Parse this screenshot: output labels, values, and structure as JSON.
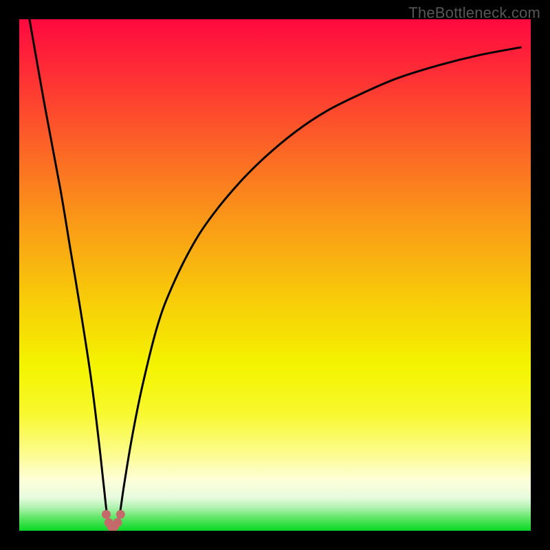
{
  "watermark": "TheBottleneck.com",
  "chart_data": {
    "type": "line",
    "title": "",
    "xlabel": "",
    "ylabel": "",
    "xlim": [
      0,
      100
    ],
    "ylim": [
      0,
      100
    ],
    "grid": false,
    "background": "red-yellow-green vertical gradient",
    "series": [
      {
        "name": "bottleneck-curve",
        "x": [
          2,
          5,
          8,
          10,
          12,
          14,
          15.5,
          16.5,
          17.2,
          18,
          18.8,
          19.6,
          20.5,
          22,
          24,
          27,
          30,
          34,
          38,
          43,
          48,
          54,
          60,
          67,
          74,
          82,
          90,
          98
        ],
        "y": [
          100,
          83,
          67,
          55,
          43,
          30,
          18,
          9,
          3,
          0,
          0,
          3,
          9,
          18,
          28,
          40,
          48,
          56,
          62,
          68,
          73,
          78,
          82,
          85.5,
          88.5,
          91,
          93,
          94.5
        ]
      }
    ],
    "markers": {
      "name": "minimum-markers",
      "color": "#c46a6a",
      "points": [
        {
          "x": 17.0,
          "y": 3.2
        },
        {
          "x": 17.5,
          "y": 1.6
        },
        {
          "x": 18.0,
          "y": 0.8
        },
        {
          "x": 18.6,
          "y": 0.8
        },
        {
          "x": 19.2,
          "y": 1.6
        },
        {
          "x": 19.8,
          "y": 3.2
        }
      ]
    },
    "gradient_stops": [
      {
        "offset": 0.0,
        "color": "#fe093f"
      },
      {
        "offset": 0.1,
        "color": "#fe2c36"
      },
      {
        "offset": 0.25,
        "color": "#fc6426"
      },
      {
        "offset": 0.4,
        "color": "#fa9b17"
      },
      {
        "offset": 0.55,
        "color": "#f7cd08"
      },
      {
        "offset": 0.68,
        "color": "#f4f400"
      },
      {
        "offset": 0.77,
        "color": "#f8f82e"
      },
      {
        "offset": 0.85,
        "color": "#fcfc8f"
      },
      {
        "offset": 0.9,
        "color": "#fefed9"
      },
      {
        "offset": 0.935,
        "color": "#e7fbde"
      },
      {
        "offset": 0.955,
        "color": "#aef2af"
      },
      {
        "offset": 0.975,
        "color": "#5de665"
      },
      {
        "offset": 1.0,
        "color": "#09d826"
      }
    ]
  }
}
